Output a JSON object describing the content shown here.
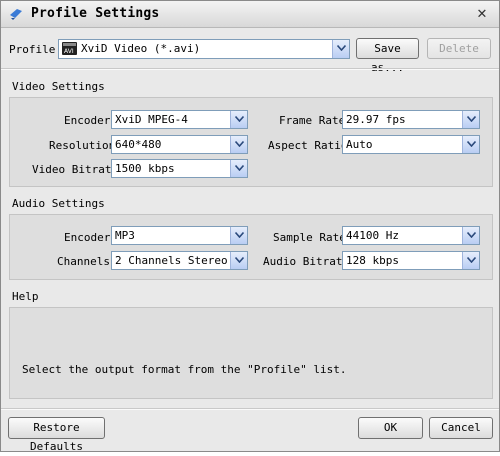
{
  "window": {
    "title": "Profile Settings",
    "close_glyph": "✕",
    "app_icon": "app-logo-icon"
  },
  "profile": {
    "label": "Profile:",
    "value": "XviD Video (*.avi)",
    "icon": "avi-format-icon",
    "save_as_label": "Save as...",
    "delete_label": "Delete"
  },
  "video": {
    "section_title": "Video Settings",
    "encoder_label": "Encoder:",
    "encoder_value": "XviD MPEG-4",
    "resolution_label": "Resolution:",
    "resolution_value": "640*480",
    "bitrate_label": "Video Bitrate:",
    "bitrate_value": "1500 kbps",
    "framerate_label": "Frame Rate:",
    "framerate_value": "29.97 fps",
    "aspect_label": "Aspect Ratio:",
    "aspect_value": "Auto"
  },
  "audio": {
    "section_title": "Audio Settings",
    "encoder_label": "Encoder:",
    "encoder_value": "MP3",
    "channels_label": "Channels:",
    "channels_value": "2 Channels Stereo",
    "samplerate_label": "Sample Rate:",
    "samplerate_value": "44100 Hz",
    "bitrate_label": "Audio Bitrate:",
    "bitrate_value": "128 kbps"
  },
  "help": {
    "section_title": "Help",
    "text": "Select the output format from the \"Profile\" list."
  },
  "footer": {
    "restore_label": "Restore Defaults",
    "ok_label": "OK",
    "cancel_label": "Cancel"
  },
  "colors": {
    "window_bg": "#e9e9e9",
    "panel_bg": "#dedede",
    "select_border": "#7f9db9",
    "arrow_fill": "#b9cdf3"
  }
}
